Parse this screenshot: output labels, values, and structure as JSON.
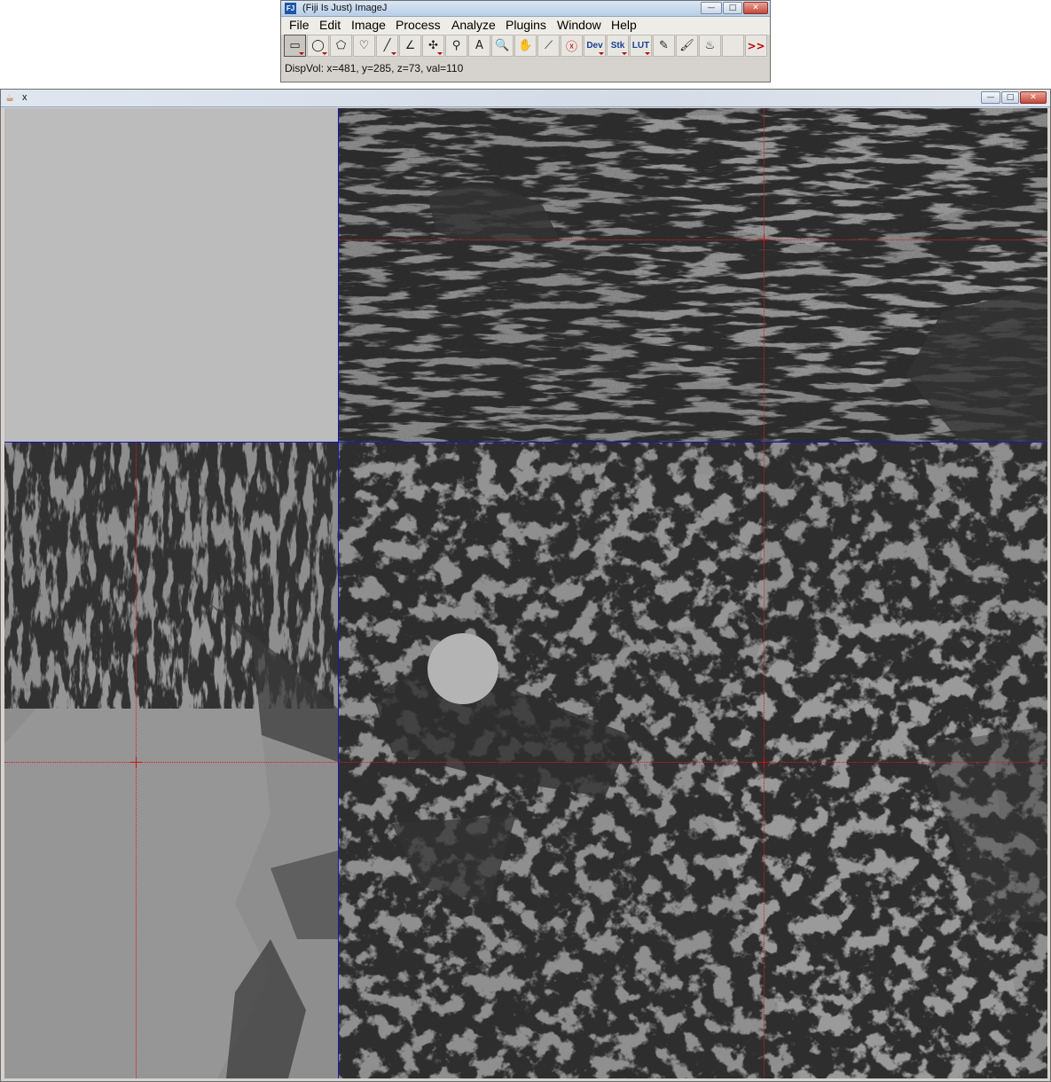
{
  "app": {
    "title": "(Fiji Is Just) ImageJ",
    "icon_label": "FJ",
    "window_controls": {
      "minimize": "—",
      "maximize": "□",
      "close": "✕"
    }
  },
  "menu": [
    "File",
    "Edit",
    "Image",
    "Process",
    "Analyze",
    "Plugins",
    "Window",
    "Help"
  ],
  "toolbar": {
    "tools": [
      {
        "name": "rectangle-tool",
        "glyph": "▭",
        "selected": true
      },
      {
        "name": "oval-tool",
        "glyph": "◯"
      },
      {
        "name": "polygon-tool",
        "glyph": "⬠"
      },
      {
        "name": "freehand-tool",
        "glyph": "♡"
      },
      {
        "name": "line-tool",
        "glyph": "╱"
      },
      {
        "name": "angle-tool",
        "glyph": "∠"
      },
      {
        "name": "point-tool",
        "glyph": "✣"
      },
      {
        "name": "wand-tool",
        "glyph": "⚲"
      },
      {
        "name": "text-tool",
        "glyph": "A"
      },
      {
        "name": "magnifier-tool",
        "glyph": "🔍"
      },
      {
        "name": "hand-tool",
        "glyph": "✋"
      },
      {
        "name": "color-picker-tool",
        "glyph": "⟋"
      },
      {
        "name": "stop-tool",
        "glyph": "ⓧ"
      },
      {
        "name": "dev-tool",
        "glyph": "Dev"
      },
      {
        "name": "stk-tool",
        "glyph": "Stk"
      },
      {
        "name": "lut-tool",
        "glyph": "LUT"
      },
      {
        "name": "pencil-tool",
        "glyph": "✎"
      },
      {
        "name": "brush-tool",
        "glyph": "🖌"
      },
      {
        "name": "flood-fill-tool",
        "glyph": "♨"
      },
      {
        "name": "empty-tool",
        "glyph": ""
      },
      {
        "name": "more-tools",
        "glyph": ">>"
      }
    ]
  },
  "status": "DispVol: x=481, y=285, z=73, val=110",
  "image_window": {
    "title": "x",
    "icon": "☕",
    "window_controls": {
      "minimize": "—",
      "maximize": "□",
      "close": "✕"
    }
  },
  "colors": {
    "divider": "#1515d0",
    "crosshair": "#e01818",
    "blank_panel": "#bcbcbc"
  }
}
